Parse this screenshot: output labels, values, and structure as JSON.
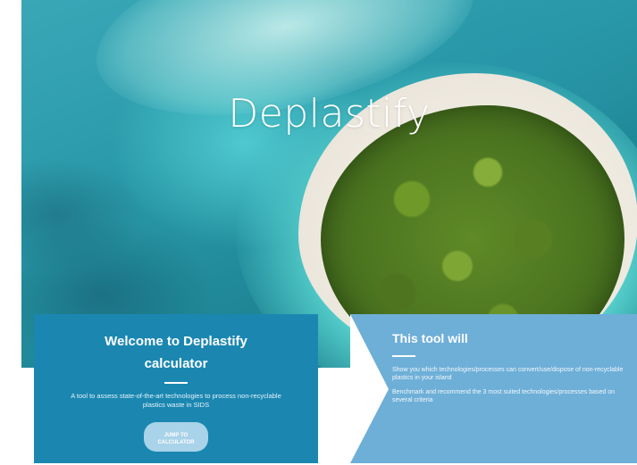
{
  "hero": {
    "title": "Deplastify"
  },
  "welcome": {
    "title_line1": "Welcome to Deplastify",
    "title_line2": "calculator",
    "description": "A tool to assess state-of-the-art technologies to process non-recyclable plastics waste in SIDS",
    "button_line1": "JUMP TO",
    "button_line2": "CALCULATOR"
  },
  "tool": {
    "title": "This tool will",
    "items": [
      "Show you which technologies/processes can convert/use/dispose of non-recyclable plastics in your island",
      "Benchmark and recommend the 3 most suited technologies/processes based on several criteria"
    ]
  },
  "colors": {
    "welcome_card": "#1b87b1",
    "tool_card": "#6eafd8",
    "button": "#a9d3e8"
  }
}
